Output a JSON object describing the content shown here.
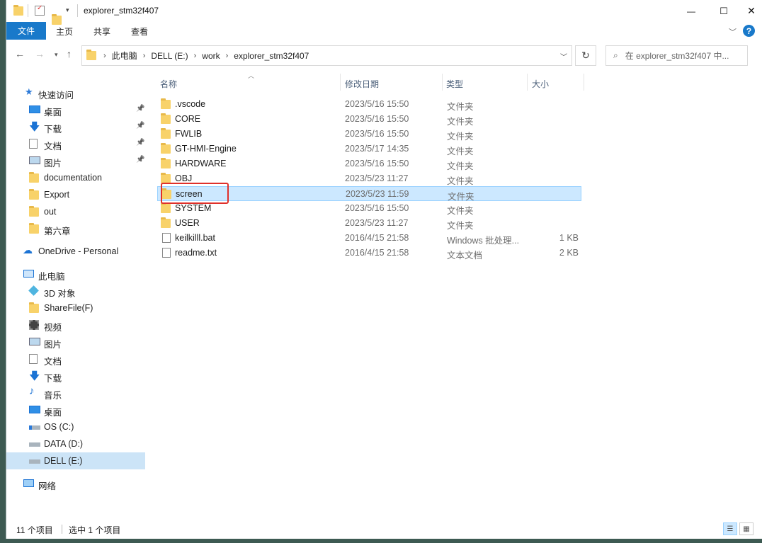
{
  "window": {
    "title": "explorer_stm32f407",
    "controls": {
      "minimize": "—",
      "maximize": "☐",
      "close": "✕"
    }
  },
  "ribbon": {
    "tabs": [
      "文件",
      "主页",
      "共享",
      "查看"
    ],
    "help": "?"
  },
  "address": {
    "crumbs": [
      "此电脑",
      "DELL (E:)",
      "work",
      "explorer_stm32f407"
    ],
    "search_placeholder": "在 explorer_stm32f407 中..."
  },
  "nav": {
    "quick_access": "快速访问",
    "quick_items": [
      {
        "label": "桌面",
        "icon": "desktop-icon",
        "pinned": true
      },
      {
        "label": "下载",
        "icon": "download-icon",
        "pinned": true
      },
      {
        "label": "文档",
        "icon": "document-icon",
        "pinned": true
      },
      {
        "label": "图片",
        "icon": "picture-icon",
        "pinned": true
      },
      {
        "label": "documentation",
        "icon": "folder-icon",
        "pinned": false
      },
      {
        "label": "Export",
        "icon": "folder-icon",
        "pinned": false
      },
      {
        "label": "out",
        "icon": "folder-icon",
        "pinned": false
      },
      {
        "label": "第六章",
        "icon": "folder-icon",
        "pinned": false
      }
    ],
    "onedrive": "OneDrive - Personal",
    "this_pc": "此电脑",
    "pc_items": [
      {
        "label": "3D 对象",
        "icon": "3d-objects-icon"
      },
      {
        "label": "ShareFile(F)",
        "icon": "folder-icon"
      },
      {
        "label": "视频",
        "icon": "video-icon"
      },
      {
        "label": "图片",
        "icon": "picture-icon"
      },
      {
        "label": "文档",
        "icon": "document-icon"
      },
      {
        "label": "下载",
        "icon": "download-icon"
      },
      {
        "label": "音乐",
        "icon": "music-icon"
      },
      {
        "label": "桌面",
        "icon": "desktop-icon"
      },
      {
        "label": "OS (C:)",
        "icon": "os-drive-icon"
      },
      {
        "label": "DATA (D:)",
        "icon": "drive-icon"
      },
      {
        "label": "DELL (E:)",
        "icon": "drive-icon",
        "selected": true
      }
    ],
    "network": "网络"
  },
  "columns": {
    "name": "名称",
    "modified": "修改日期",
    "type": "类型",
    "size": "大小"
  },
  "files": [
    {
      "name": ".vscode",
      "modified": "2023/5/16 15:50",
      "type": "文件夹",
      "size": "",
      "kind": "folder"
    },
    {
      "name": "CORE",
      "modified": "2023/5/16 15:50",
      "type": "文件夹",
      "size": "",
      "kind": "folder"
    },
    {
      "name": "FWLIB",
      "modified": "2023/5/16 15:50",
      "type": "文件夹",
      "size": "",
      "kind": "folder"
    },
    {
      "name": "GT-HMI-Engine",
      "modified": "2023/5/17 14:35",
      "type": "文件夹",
      "size": "",
      "kind": "folder"
    },
    {
      "name": "HARDWARE",
      "modified": "2023/5/16 15:50",
      "type": "文件夹",
      "size": "",
      "kind": "folder"
    },
    {
      "name": "OBJ",
      "modified": "2023/5/23 11:27",
      "type": "文件夹",
      "size": "",
      "kind": "folder"
    },
    {
      "name": "screen",
      "modified": "2023/5/23 11:59",
      "type": "文件夹",
      "size": "",
      "kind": "folder",
      "selected": true
    },
    {
      "name": "SYSTEM",
      "modified": "2023/5/16 15:50",
      "type": "文件夹",
      "size": "",
      "kind": "folder"
    },
    {
      "name": "USER",
      "modified": "2023/5/23 11:27",
      "type": "文件夹",
      "size": "",
      "kind": "folder"
    },
    {
      "name": "keilkilll.bat",
      "modified": "2016/4/15 21:58",
      "type": "Windows 批处理...",
      "size": "1 KB",
      "kind": "bat"
    },
    {
      "name": "readme.txt",
      "modified": "2016/4/15 21:58",
      "type": "文本文档",
      "size": "2 KB",
      "kind": "txt"
    }
  ],
  "status": {
    "count": "11 个项目",
    "selection": "选中 1 个项目"
  }
}
